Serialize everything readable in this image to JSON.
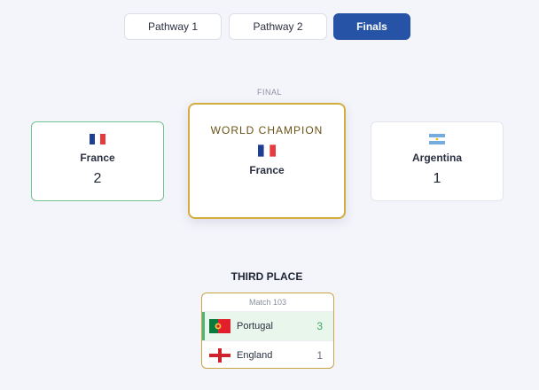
{
  "tabs": [
    {
      "label": "Pathway 1",
      "active": false
    },
    {
      "label": "Pathway 2",
      "active": false
    },
    {
      "label": "Finals",
      "active": true
    }
  ],
  "final": {
    "label": "FINAL",
    "team_left": {
      "name": "France",
      "score": "2",
      "flag": "france-flag-icon",
      "winner": true
    },
    "team_right": {
      "name": "Argentina",
      "score": "1",
      "flag": "argentina-flag-icon",
      "winner": false
    },
    "champion": {
      "title": "WORLD CHAMPION",
      "name": "France",
      "flag": "france-flag-icon"
    }
  },
  "third_place": {
    "title": "THIRD PLACE",
    "match_label": "Match 103",
    "teams": [
      {
        "name": "Portugal",
        "score": "3",
        "flag": "portugal-flag-icon",
        "winner": true
      },
      {
        "name": "England",
        "score": "1",
        "flag": "england-flag-icon",
        "winner": false
      }
    ]
  },
  "colors": {
    "accent": "#2653a6",
    "champion_border": "#d4ad3f",
    "winner_border": "#6fc38c",
    "winner_row_bg": "#e8f6ec",
    "page_bg": "#f4f5fb"
  }
}
